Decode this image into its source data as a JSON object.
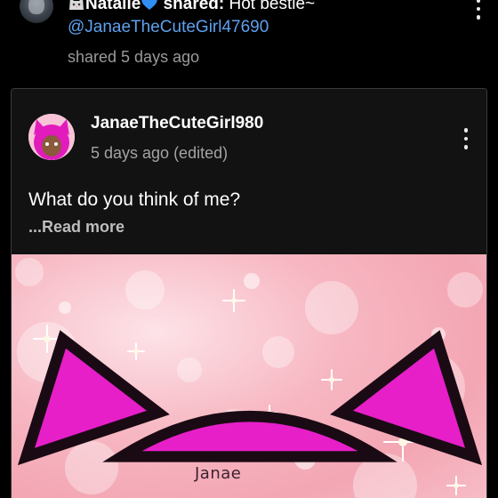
{
  "share": {
    "sharer_name": "Natalie",
    "sharer_prefix_emoji": "cat-face-emoji",
    "sharer_suffix_emoji": "blue-heart-emoji",
    "shared_label": "shared:",
    "caption": "Hot bestie~",
    "mention": "@JanaeTheCuteGirl47690",
    "time": "shared 5 days ago"
  },
  "post": {
    "author": "JanaeTheCuteGirl980",
    "time": "5 days ago (edited)",
    "text": "What do you think of me?",
    "read_more": "...Read more",
    "image_caption": "Janae"
  },
  "colors": {
    "background": "#000000",
    "card": "#121212",
    "link": "#5fa0ee",
    "muted": "#9a9a9a",
    "image_pink": "#f3a6b3",
    "cat_magenta": "#e61fc9"
  }
}
